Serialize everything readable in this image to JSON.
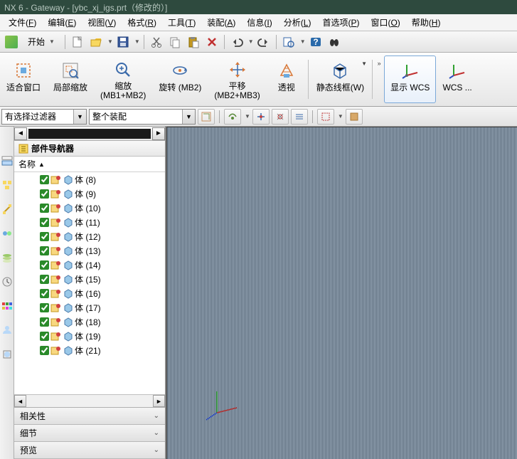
{
  "title": "NX 6 - Gateway - [ybc_xj_igs.prt（修改的）]",
  "menu": [
    {
      "label": "文件",
      "key": "F"
    },
    {
      "label": "编辑",
      "key": "E"
    },
    {
      "label": "视图",
      "key": "V"
    },
    {
      "label": "格式",
      "key": "R"
    },
    {
      "label": "工具",
      "key": "T"
    },
    {
      "label": "装配",
      "key": "A"
    },
    {
      "label": "信息",
      "key": "I"
    },
    {
      "label": "分析",
      "key": "L"
    },
    {
      "label": "首选项",
      "key": "P"
    },
    {
      "label": "窗口",
      "key": "O"
    },
    {
      "label": "帮助",
      "key": "H"
    }
  ],
  "toolbar1": {
    "start": "开始"
  },
  "ribbon": [
    {
      "id": "fit-window",
      "label": "适合窗口",
      "sub": ""
    },
    {
      "id": "local-zoom",
      "label": "局部缩放",
      "sub": ""
    },
    {
      "id": "zoom",
      "label": "缩放",
      "sub": "(MB1+MB2)"
    },
    {
      "id": "rotate",
      "label": "旋转 (MB2)",
      "sub": ""
    },
    {
      "id": "pan",
      "label": "平移",
      "sub": "(MB2+MB3)"
    },
    {
      "id": "perspective",
      "label": "透视",
      "sub": ""
    },
    {
      "id": "wireframe",
      "label": "静态线框(W)",
      "sub": "",
      "arrow": true
    },
    {
      "id": "show-wcs",
      "label": "显示 WCS",
      "sub": "",
      "active": true
    },
    {
      "id": "wcs",
      "label": "WCS ...",
      "sub": ""
    }
  ],
  "filter": {
    "combo1": "有选择过滤器",
    "combo2": "整个装配"
  },
  "nav": {
    "title": "部件导航器",
    "col_name": "名称",
    "items": [
      {
        "label": "体 (8)"
      },
      {
        "label": "体 (9)"
      },
      {
        "label": "体 (10)"
      },
      {
        "label": "体 (11)"
      },
      {
        "label": "体 (12)"
      },
      {
        "label": "体 (13)"
      },
      {
        "label": "体 (14)"
      },
      {
        "label": "体 (15)"
      },
      {
        "label": "体 (16)"
      },
      {
        "label": "体 (17)"
      },
      {
        "label": "体 (18)"
      },
      {
        "label": "体 (19)"
      },
      {
        "label": "体 (21)"
      }
    ],
    "acc": [
      "相关性",
      "细节",
      "预览"
    ]
  }
}
